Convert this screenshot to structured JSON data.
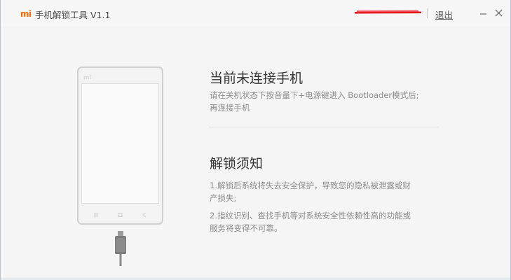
{
  "app": {
    "logo": "mi",
    "title": "手机解锁工具 V1.1",
    "account": "",
    "logout_label": "退出"
  },
  "colors": {
    "brand": "#ff6a00",
    "redaction": "#e8141c"
  },
  "icons": {
    "minimize": "minimize-icon",
    "close": "close-icon",
    "phone_keys": [
      "menu-icon",
      "home-icon",
      "back-icon"
    ],
    "cable": "usb-cable-icon"
  },
  "phone": {
    "logo": "mi"
  },
  "connect_section": {
    "heading": "当前未连接手机",
    "instruction_line1": "请在关机状态下按音量下+电源键进入 Bootloader模式后;",
    "instruction_line2": "再连接手机"
  },
  "notice_section": {
    "heading": "解锁须知",
    "item1_line1": "1.解锁后系统将失去安全保护，导致您的隐私被泄露或财",
    "item1_line2": "产损失;",
    "item2_line1": "2.指纹识别、查找手机等对系统安全性依赖性高的功能或",
    "item2_line2": "服务将变得不可靠。"
  }
}
